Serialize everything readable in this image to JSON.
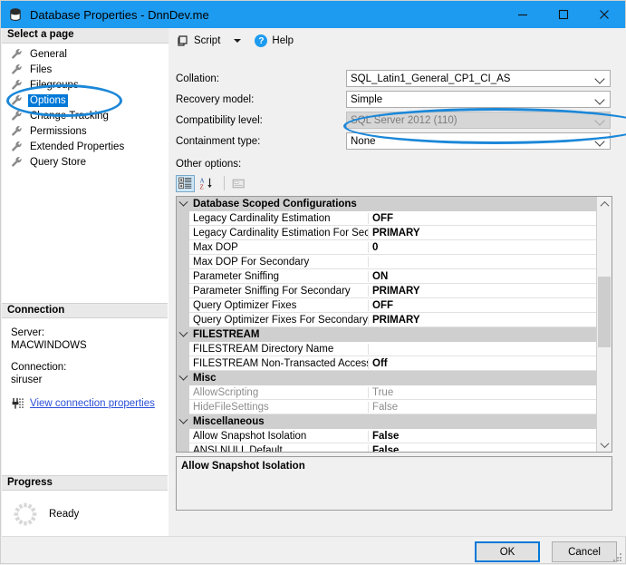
{
  "window": {
    "title": "Database Properties - DnnDev.me",
    "icon": "database-icon",
    "minimize": "—",
    "maximize": "☐",
    "close": "✕"
  },
  "sidebar": {
    "header": "Select a page",
    "items": [
      {
        "label": "General",
        "selected": false
      },
      {
        "label": "Files",
        "selected": false
      },
      {
        "label": "Filegroups",
        "selected": false
      },
      {
        "label": "Options",
        "selected": true
      },
      {
        "label": "Change Tracking",
        "selected": false
      },
      {
        "label": "Permissions",
        "selected": false
      },
      {
        "label": "Extended Properties",
        "selected": false
      },
      {
        "label": "Query Store",
        "selected": false
      }
    ],
    "connection": {
      "header": "Connection",
      "server_label": "Server:",
      "server_value": "MACWINDOWS",
      "connection_label": "Connection:",
      "connection_value": "siruser",
      "link": "View connection properties"
    },
    "progress": {
      "header": "Progress",
      "status": "Ready"
    }
  },
  "toolbar": {
    "script_label": "Script",
    "help_label": "Help",
    "help_glyph": "?"
  },
  "form": {
    "fields": [
      {
        "label": "Collation:",
        "value": "SQL_Latin1_General_CP1_CI_AS",
        "disabled": false
      },
      {
        "label": "Recovery model:",
        "value": "Simple",
        "disabled": false
      },
      {
        "label": "Compatibility level:",
        "value": "SQL Server 2012 (110)",
        "disabled": true
      },
      {
        "label": "Containment type:",
        "value": "None",
        "disabled": false
      }
    ],
    "other_options_label": "Other options:"
  },
  "grid_toolbar": {
    "categorized": "categorized-view-button",
    "alphabetical": "alphabetical-sort-button",
    "property_pages": "property-pages-button"
  },
  "property_grid": {
    "rows": [
      {
        "kind": "category",
        "name": "Database Scoped Configurations"
      },
      {
        "kind": "item",
        "name": "Legacy Cardinality Estimation",
        "value": "OFF",
        "dim": false
      },
      {
        "kind": "item",
        "name": "Legacy Cardinality Estimation For Secondary",
        "value": "PRIMARY",
        "dim": false
      },
      {
        "kind": "item",
        "name": "Max DOP",
        "value": "0",
        "dim": false
      },
      {
        "kind": "item",
        "name": "Max DOP For Secondary",
        "value": "",
        "dim": false
      },
      {
        "kind": "item",
        "name": "Parameter Sniffing",
        "value": "ON",
        "dim": false
      },
      {
        "kind": "item",
        "name": "Parameter Sniffing For Secondary",
        "value": "PRIMARY",
        "dim": false
      },
      {
        "kind": "item",
        "name": "Query Optimizer Fixes",
        "value": "OFF",
        "dim": false
      },
      {
        "kind": "item",
        "name": "Query Optimizer Fixes For Secondary",
        "value": "PRIMARY",
        "dim": false
      },
      {
        "kind": "category",
        "name": "FILESTREAM"
      },
      {
        "kind": "item",
        "name": "FILESTREAM Directory Name",
        "value": "",
        "dim": false
      },
      {
        "kind": "item",
        "name": "FILESTREAM Non-Transacted Access",
        "value": "Off",
        "dim": false
      },
      {
        "kind": "category",
        "name": "Misc"
      },
      {
        "kind": "item",
        "name": "AllowScripting",
        "value": "True",
        "dim": true
      },
      {
        "kind": "item",
        "name": "HideFileSettings",
        "value": "False",
        "dim": true
      },
      {
        "kind": "category",
        "name": "Miscellaneous"
      },
      {
        "kind": "item",
        "name": "Allow Snapshot Isolation",
        "value": "False",
        "dim": false
      },
      {
        "kind": "item",
        "name": "ANSI NULL Default",
        "value": "False",
        "dim": false
      }
    ]
  },
  "description": {
    "title": "Allow Snapshot Isolation"
  },
  "footer": {
    "ok": "OK",
    "cancel": "Cancel"
  },
  "colors": {
    "titlebar": "#1d9bf0",
    "accent": "#0078d7",
    "annotation": "#1b87d8",
    "selection": "#0078d7",
    "link": "#2a4fd7"
  }
}
